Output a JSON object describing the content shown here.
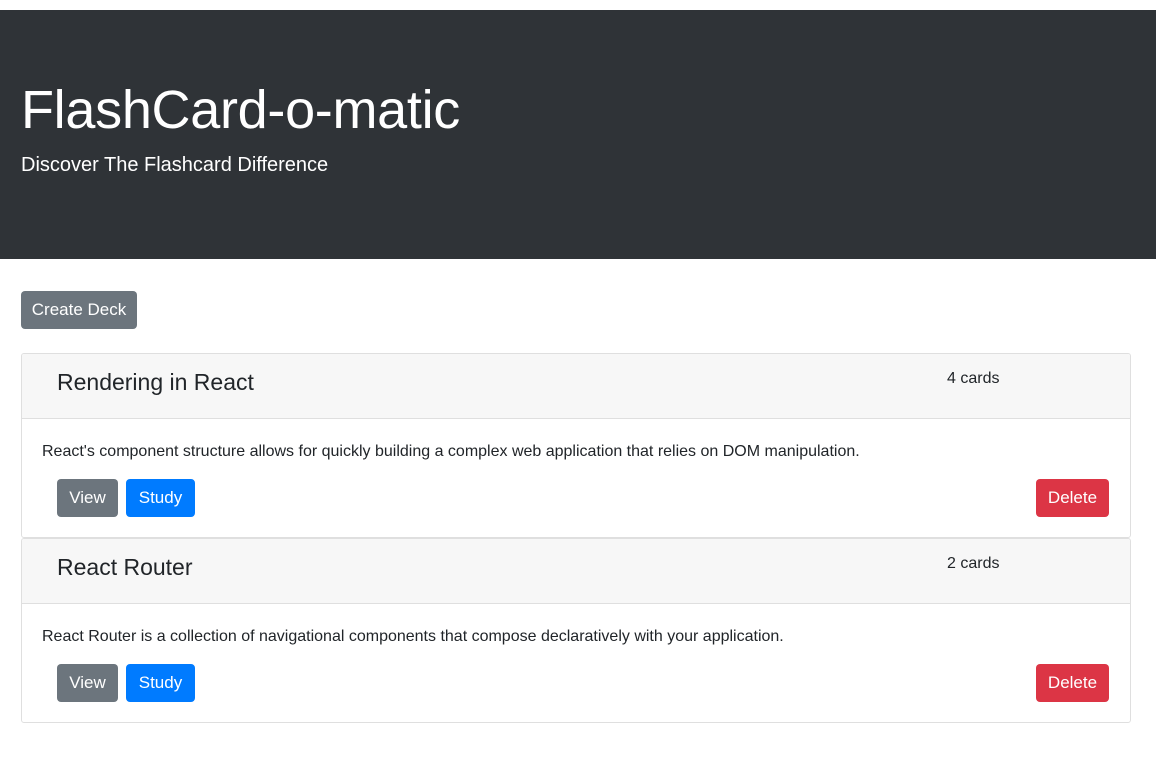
{
  "header": {
    "title": "FlashCard-o-matic",
    "subtitle": "Discover The Flashcard Difference"
  },
  "toolbar": {
    "create_deck_label": "Create Deck"
  },
  "decks": [
    {
      "name": "Rendering in React",
      "count": "4 cards",
      "description": "React's component structure allows for quickly building a complex web application that relies on DOM manipulation.",
      "view_label": "View",
      "study_label": "Study",
      "delete_label": "Delete"
    },
    {
      "name": "React Router",
      "count": "2 cards",
      "description": "React Router is a collection of navigational components that compose declaratively with your application.",
      "view_label": "View",
      "study_label": "Study",
      "delete_label": "Delete"
    }
  ],
  "colors": {
    "header_bg": "#2f3337",
    "secondary": "#6c757d",
    "primary": "#007bff",
    "danger": "#dc3545"
  }
}
